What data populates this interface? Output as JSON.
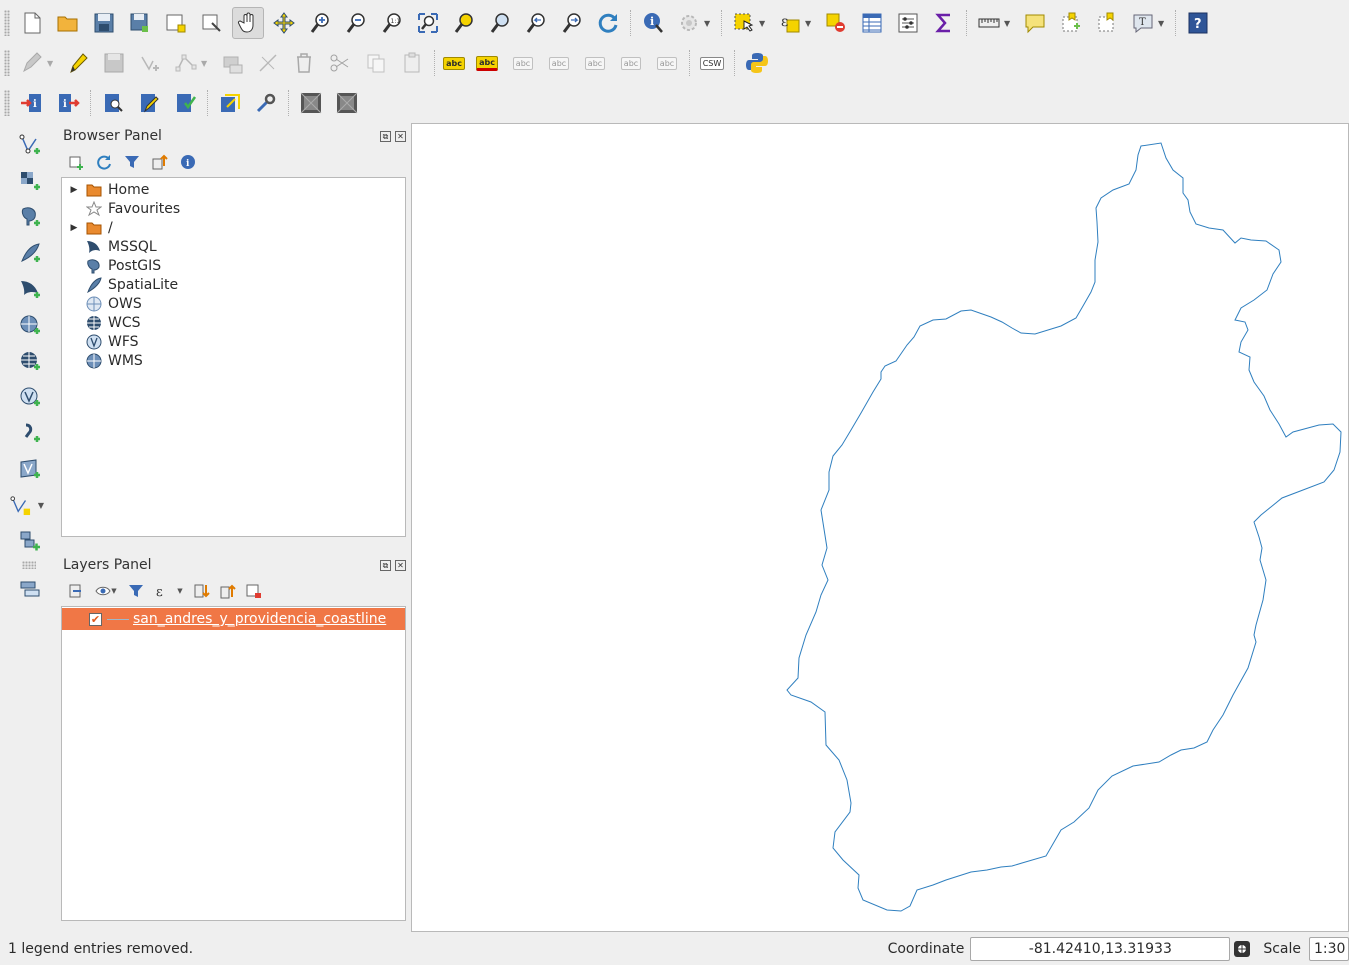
{
  "toolbar_row1": [
    {
      "icon": "new-project-icon"
    },
    {
      "icon": "open-project-icon"
    },
    {
      "icon": "save-project-icon"
    },
    {
      "icon": "save-as-icon"
    },
    {
      "icon": "new-print-composer-icon"
    },
    {
      "icon": "composer-manager-icon"
    },
    {
      "icon": "pan-icon",
      "active": true
    },
    {
      "icon": "pan-to-selection-icon"
    },
    {
      "icon": "zoom-in-icon"
    },
    {
      "icon": "zoom-out-icon"
    },
    {
      "icon": "zoom-native-icon"
    },
    {
      "icon": "zoom-full-icon"
    },
    {
      "icon": "zoom-to-selection-icon"
    },
    {
      "icon": "zoom-to-layer-icon"
    },
    {
      "icon": "zoom-last-icon"
    },
    {
      "icon": "zoom-next-icon"
    },
    {
      "icon": "refresh-icon"
    },
    {
      "icon": "identify-icon"
    },
    {
      "icon": "action-icon"
    },
    {
      "icon": "select-icon"
    },
    {
      "icon": "select-expression-icon"
    },
    {
      "icon": "deselect-icon"
    },
    {
      "icon": "attribute-table-icon"
    },
    {
      "icon": "field-calculator-icon"
    },
    {
      "icon": "statistics-icon"
    },
    {
      "icon": "measure-icon"
    },
    {
      "icon": "annotation-icon"
    },
    {
      "icon": "add-bookmark-icon"
    },
    {
      "icon": "show-bookmarks-icon"
    },
    {
      "icon": "text-annotation-icon"
    },
    {
      "icon": "help-icon"
    }
  ],
  "toolbar_row2_labels": {
    "abc": "abc",
    "csw": "CSW"
  },
  "browser_panel": {
    "title": "Browser Panel",
    "items": [
      {
        "label": "Home",
        "icon": "folder-icon",
        "expandable": true
      },
      {
        "label": "Favourites",
        "icon": "star-icon",
        "expandable": false
      },
      {
        "label": "/",
        "icon": "folder-icon",
        "expandable": true
      },
      {
        "label": "MSSQL",
        "icon": "mssql-icon",
        "expandable": false
      },
      {
        "label": "PostGIS",
        "icon": "postgis-icon",
        "expandable": false
      },
      {
        "label": "SpatiaLite",
        "icon": "spatialite-icon",
        "expandable": false
      },
      {
        "label": "OWS",
        "icon": "ows-icon",
        "expandable": false
      },
      {
        "label": "WCS",
        "icon": "wcs-icon",
        "expandable": false
      },
      {
        "label": "WFS",
        "icon": "wfs-icon",
        "expandable": false
      },
      {
        "label": "WMS",
        "icon": "wms-icon",
        "expandable": false
      }
    ]
  },
  "layers_panel": {
    "title": "Layers Panel",
    "layers": [
      {
        "name": "san_andres_y_providencia_coastline",
        "checked": true,
        "selected": true,
        "color": "#f07746"
      }
    ]
  },
  "status": {
    "message": "1 legend entries removed.",
    "coordinate_label": "Coordinate",
    "coordinate_value": "-81.42410,13.31933",
    "scale_label": "Scale",
    "scale_value": "1:30"
  },
  "colors": {
    "accent": "#f07746",
    "coastline": "#2f7fbf"
  }
}
